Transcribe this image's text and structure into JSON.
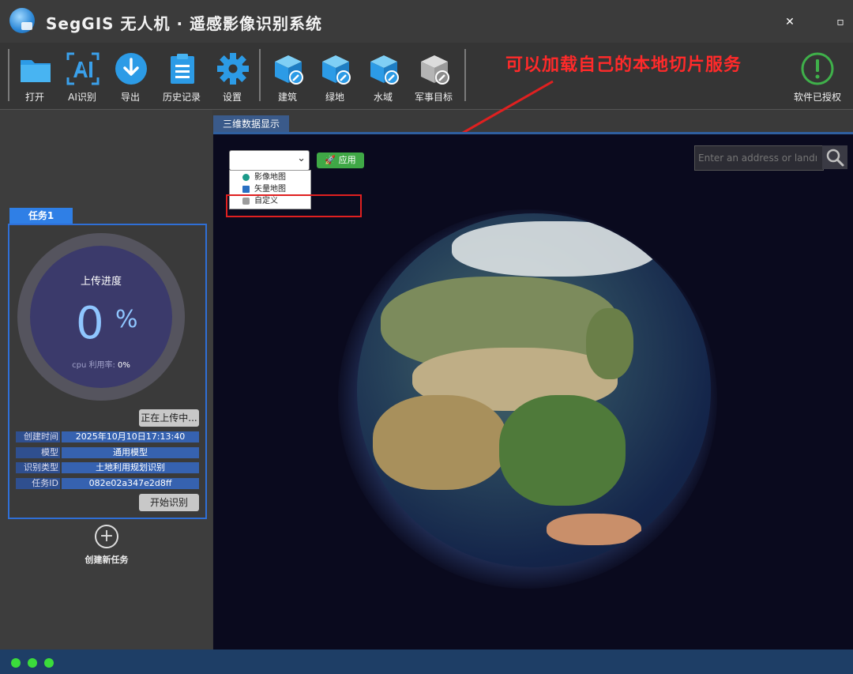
{
  "window": {
    "title": "SegGIS 无人机 · 遥感影像识别系统",
    "close_glyph": "✕",
    "restore_glyph": "▫"
  },
  "toolbar": {
    "items": [
      {
        "label": "打开",
        "icon": "folder-icon"
      },
      {
        "label": "AI识别",
        "icon": "ai-recognize-icon"
      },
      {
        "label": "导出",
        "icon": "download-icon"
      },
      {
        "label": "历史记录",
        "icon": "clipboard-icon"
      },
      {
        "label": "设置",
        "icon": "gear-icon"
      },
      {
        "label": "建筑",
        "icon": "building-cube-icon"
      },
      {
        "label": "绿地",
        "icon": "greenland-cube-icon"
      },
      {
        "label": "水域",
        "icon": "water-cube-icon"
      },
      {
        "label": "军事目标",
        "icon": "military-cube-icon"
      },
      {
        "label": "软件已授权",
        "icon": "license-check-icon"
      }
    ]
  },
  "annotation": {
    "text": "可以加载自己的本地切片服务",
    "color": "#ff2a2a"
  },
  "task": {
    "tab_label": "任务1",
    "progress_title": "上传进度",
    "progress_value": "0",
    "progress_unit": "%",
    "cpu_label": "cpu 利用率:",
    "cpu_value": "0%",
    "uploading_button": "正在上传中...",
    "info": [
      {
        "key": "创建时间",
        "value": "2025年10月10日17:13:40"
      },
      {
        "key": "模型",
        "value": "通用模型"
      },
      {
        "key": "识别类型",
        "value": "土地利用规划识别"
      },
      {
        "key": "任务ID",
        "value": "082e02a347e2d8ff"
      }
    ],
    "start_button": "开始识别"
  },
  "new_task": {
    "label": "创建新任务"
  },
  "viewer": {
    "tab_label": "三维数据显示",
    "basemap_select_value": "",
    "apply_button": "应用",
    "basemap_options": [
      {
        "label": "影像地图",
        "icon": "globe-icon"
      },
      {
        "label": "矢量地图",
        "icon": "map-book-icon"
      },
      {
        "label": "自定义",
        "icon": "link-icon"
      }
    ],
    "search_placeholder": "Enter an address or landn"
  },
  "colors": {
    "accent_blue": "#2f7fe6",
    "apply_green": "#3fa846",
    "status_dot_green": "#3bdc3b",
    "progress_text": "#8fc6ff"
  }
}
